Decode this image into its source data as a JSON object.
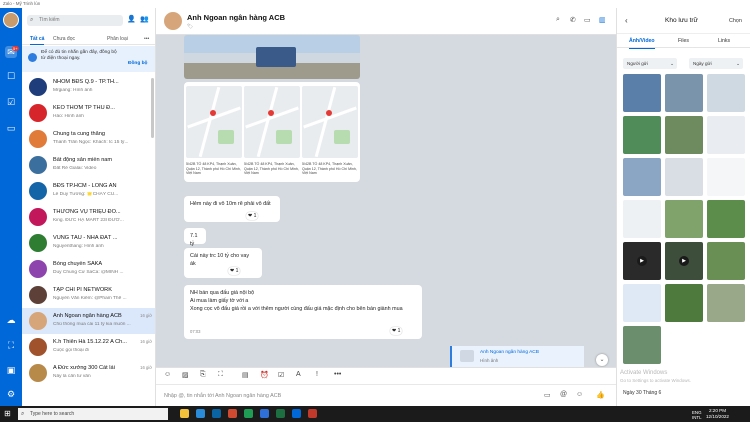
{
  "window": {
    "title": "Zalo - Mỹ Trinh lùn"
  },
  "rail": {
    "badge": "5+"
  },
  "conv_panel": {
    "search_placeholder": "Tìm kiếm",
    "tabs": {
      "all": "Tất cả",
      "other": "Chưa đọc",
      "classify": "Phân loại",
      "more": "•••"
    },
    "notice": {
      "text": "Để có đủ tin nhắn gần đây, đồng bộ từ điện thoại ngay.",
      "button": "Đồng bộ"
    },
    "conversations": [
      {
        "name": "NHÓM BĐS Q.9 - TP.TH...",
        "preview": "Mrgiang:  Hình ảnh",
        "time": "",
        "color": "#1f3d7a",
        "unread": false
      },
      {
        "name": "KÈO THƠM TP THỦ Đ...",
        "preview": "Hảo:  Hình ảnh",
        "time": "",
        "color": "#d7262b",
        "unread": false
      },
      {
        "name": "Chung ta cung thắng",
        "preview": "Thành Trần Ngọc: Khách: tc 15 tỷ...",
        "time": "",
        "color": "#e07b39",
        "unread": false
      },
      {
        "name": "Bất động sản miền nam",
        "preview": "Đất Rẻ Gialai:  Video",
        "time": "",
        "color": "#3b6f9e",
        "unread": false
      },
      {
        "name": "BĐS TP.HCM - LONG AN",
        "preview": "Lê Duy Tường: 🌟CHÁY CỦ...",
        "time": "",
        "color": "#1465a8",
        "unread": false
      },
      {
        "name": "THƯƠNG VỤ TRIỆU ĐÔ...",
        "preview": "King. ĐỨC HẠ MART 23l ĐƯỜ...",
        "time": "",
        "color": "#c2185b",
        "unread": false
      },
      {
        "name": "VŨNG TÀU - NHÀ ĐẤT ...",
        "preview": "Nguyenthang:  Hình ảnh",
        "time": "",
        "color": "#2e7d32",
        "unread": false
      },
      {
        "name": "Bóng chuyền SAKA",
        "preview": "Duy Chung Cư SaCa: @MINH ...",
        "time": "",
        "color": "#8e44ad",
        "unread": false
      },
      {
        "name": "TẠP CHÍ PI NETWORK",
        "preview": "Nguyễn Văn Kiếm: @Pham Thế ...",
        "time": "",
        "color": "#5d4037",
        "unread": false
      },
      {
        "name": "Anh Ngoan ngân hàng ACB",
        "preview": "Chủ thông mua cái 11 tỷ kia muốn ...",
        "time": "16 giờ",
        "color": "#d6a67a",
        "unread": false
      },
      {
        "name": "K.h Thiên Hà 15.12.22 A Ch...",
        "preview": "Cuộc gọi thoại đi",
        "time": "16 giờ",
        "color": "#a0522d",
        "unread": false
      },
      {
        "name": "A Đức xưởng 300 Cát lái",
        "preview": "Nây là cần tư vấn",
        "time": "16 giờ",
        "color": "#b88a4a",
        "unread": false
      }
    ]
  },
  "chat": {
    "name": "Anh Ngoan ngân hàng ACB",
    "tag": "🏷",
    "map_caption": "5/42B TỔ 48 KP4, Thạnh Xuân, Quận 12, Thành phố Hồ Chí Minh, Việt Nam",
    "messages": [
      {
        "text": "Hẻm này đi vô 10m rẽ phải vô đất",
        "reaction": "❤ 1"
      },
      {
        "text": "7.1 tỷ",
        "reaction": ""
      },
      {
        "text": "Cái này trc 10 tỷ cho vay ák",
        "reaction": "❤ 1"
      }
    ],
    "long_message": {
      "line1": "NH bán qua đấu giá nội bộ",
      "line2": "Ai mua làm giấy tờ với a",
      "line3": "Xong cọc vô đấu giá rồi a với thêm người cùng đấu giá mặc định cho bên bán giành mua",
      "time": "07:03",
      "reaction": "❤ 1"
    },
    "quoted": {
      "title": "Anh Ngoan ngân hàng ACB",
      "sub": "Hình ảnh"
    },
    "input_placeholder": "Nhập @, tin nhắn tới Anh Ngoan ngân hàng ACB"
  },
  "storage": {
    "title": "Kho lưu trữ",
    "select": "Chọn",
    "tabs": [
      "Ảnh/Video",
      "Files",
      "Links"
    ],
    "filter_sender": "Người gửi",
    "filter_date": "Ngày gửi",
    "date_section": "Ngày 30 Tháng 6"
  },
  "watermark": {
    "line1": "Activate Windows",
    "line2": "Go to Settings to activate Windows."
  },
  "taskbar": {
    "search": "Type here to search",
    "lang": "ENG",
    "lang2": "INTL",
    "time": "2:20 PM",
    "date": "12/10/2022"
  }
}
